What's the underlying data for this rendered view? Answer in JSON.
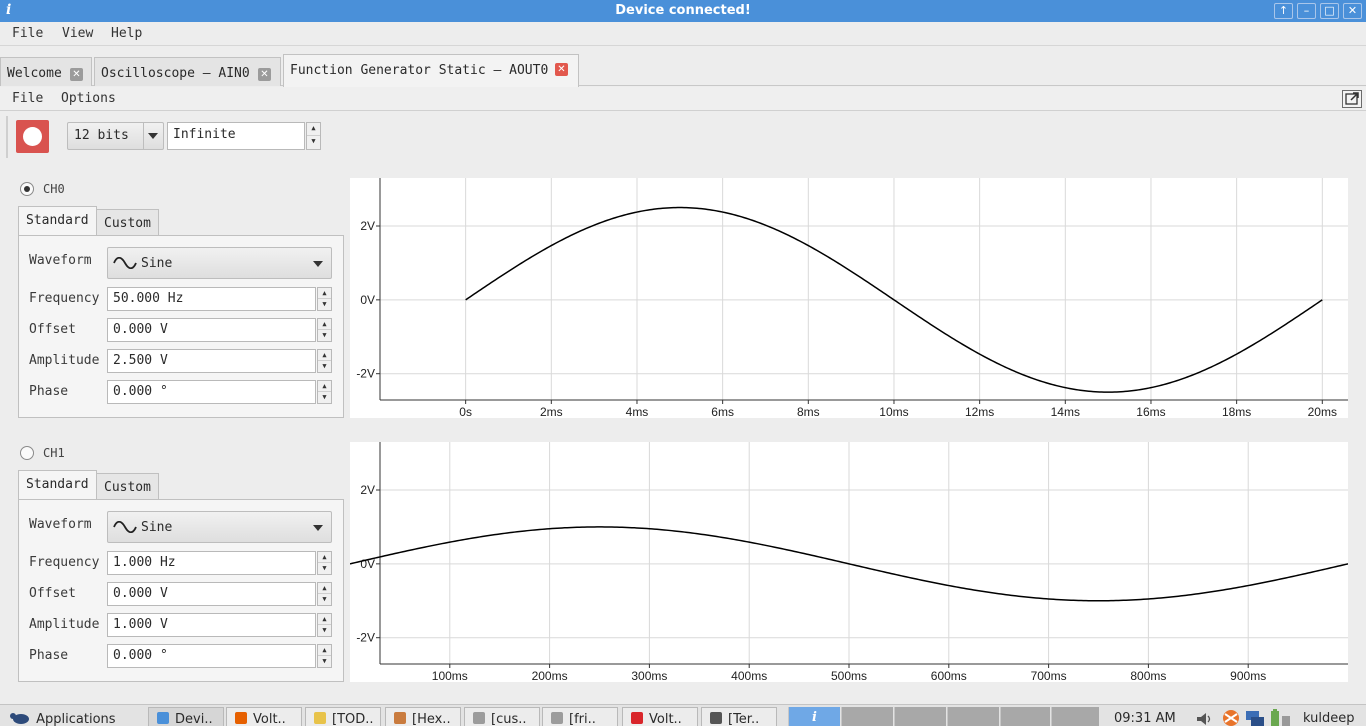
{
  "window": {
    "title": "Device connected!",
    "app_icon_glyph": "i",
    "controls": [
      "↑",
      "–",
      "□",
      "✕"
    ]
  },
  "main_menu": {
    "items": [
      "File",
      "View",
      "Help"
    ]
  },
  "tabs": [
    {
      "label": "Welcome",
      "active": false
    },
    {
      "label": "Oscilloscope – AIN0",
      "active": false
    },
    {
      "label": "Function Generator Static – AOUT0",
      "active": true
    }
  ],
  "sub_menu": {
    "items": [
      "File",
      "Options"
    ]
  },
  "toolbar": {
    "resolution": "12 bits",
    "duration": "Infinite",
    "accent_color": "#d9534f"
  },
  "channels": [
    {
      "name": "CH0",
      "selected": true,
      "tabs": [
        "Standard",
        "Custom"
      ],
      "waveform_label": "Waveform",
      "waveform": "Sine",
      "fields": [
        {
          "label": "Frequency",
          "value": "50.000 Hz"
        },
        {
          "label": "Offset",
          "value": "0.000 V"
        },
        {
          "label": "Amplitude",
          "value": "2.500 V"
        },
        {
          "label": "Phase",
          "value": "0.000 °"
        }
      ]
    },
    {
      "name": "CH1",
      "selected": false,
      "tabs": [
        "Standard",
        "Custom"
      ],
      "waveform_label": "Waveform",
      "waveform": "Sine",
      "fields": [
        {
          "label": "Frequency",
          "value": "1.000 Hz"
        },
        {
          "label": "Offset",
          "value": "0.000 V"
        },
        {
          "label": "Amplitude",
          "value": "1.000 V"
        },
        {
          "label": "Phase",
          "value": "0.000 °"
        }
      ]
    }
  ],
  "chart_data": [
    {
      "type": "line",
      "series": [
        {
          "frequency_hz": 50,
          "amplitude_v": 2.5,
          "offset_v": 0,
          "phase_deg": 0
        }
      ],
      "x_ticks": [
        "0s",
        "2ms",
        "4ms",
        "6ms",
        "8ms",
        "10ms",
        "12ms",
        "14ms",
        "16ms",
        "18ms",
        "20ms"
      ],
      "x_tick_values": [
        0,
        2,
        4,
        6,
        8,
        10,
        12,
        14,
        16,
        18,
        20
      ],
      "x_unit": "ms",
      "xlim": [
        -2.7,
        20.6
      ],
      "y_ticks": [
        "2V",
        "0V",
        "-2V"
      ],
      "y_tick_values": [
        2,
        0,
        -2
      ],
      "ylim": [
        -3.2,
        3.3
      ],
      "grid": true,
      "line_color": "#000000"
    },
    {
      "type": "line",
      "series": [
        {
          "frequency_hz": 1,
          "amplitude_v": 1.0,
          "offset_v": 0,
          "phase_deg": 0
        }
      ],
      "x_ticks": [
        "100ms",
        "200ms",
        "300ms",
        "400ms",
        "500ms",
        "600ms",
        "700ms",
        "800ms",
        "900ms"
      ],
      "x_tick_values": [
        100,
        200,
        300,
        400,
        500,
        600,
        700,
        800,
        900
      ],
      "x_unit": "ms",
      "xlim": [
        0,
        1000
      ],
      "y_ticks": [
        "2V",
        "0V",
        "-2V"
      ],
      "y_tick_values": [
        2,
        0,
        -2
      ],
      "ylim": [
        -3.2,
        3.3
      ],
      "grid": true,
      "line_color": "#000000"
    }
  ],
  "taskbar": {
    "start_label": "Applications",
    "items": [
      {
        "label": "Devi..",
        "icon_color": "#4a90d9",
        "active": true
      },
      {
        "label": "Volt..",
        "icon_color": "#e66000",
        "active": false
      },
      {
        "label": "[TOD..",
        "icon_color": "#e8c34a",
        "active": false
      },
      {
        "label": "[Hex..",
        "icon_color": "#c97b3e",
        "active": false
      },
      {
        "label": "[cus..",
        "icon_color": "#9c9c9c",
        "active": false
      },
      {
        "label": "[fri..",
        "icon_color": "#9c9c9c",
        "active": false
      },
      {
        "label": "Volt..",
        "icon_color": "#d9262b",
        "active": false
      },
      {
        "label": "[Ter..",
        "icon_color": "#555555",
        "active": false
      }
    ],
    "workspace_glyph": "i",
    "clock": "09:31 AM",
    "user": "kuldeep"
  }
}
